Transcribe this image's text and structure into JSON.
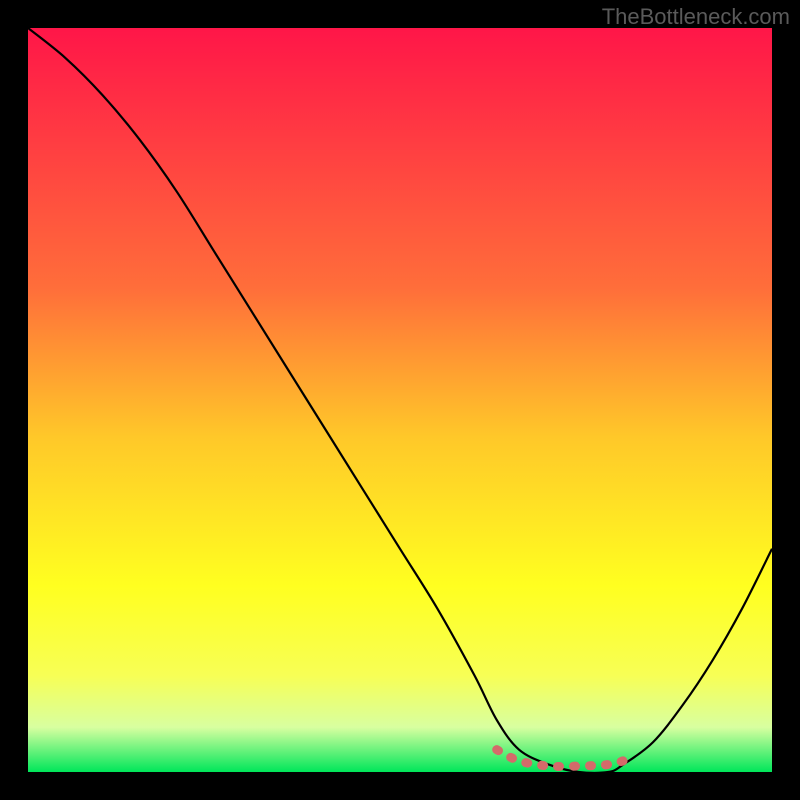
{
  "watermark": "TheBottleneck.com",
  "chart_data": {
    "type": "line",
    "title": "",
    "xlabel": "",
    "ylabel": "",
    "xlim": [
      0,
      100
    ],
    "ylim": [
      0,
      100
    ],
    "gradient_stops": [
      {
        "offset": 0,
        "color": "#ff1648"
      },
      {
        "offset": 35,
        "color": "#ff6e3a"
      },
      {
        "offset": 55,
        "color": "#ffc829"
      },
      {
        "offset": 75,
        "color": "#ffff20"
      },
      {
        "offset": 87,
        "color": "#f7ff55"
      },
      {
        "offset": 94,
        "color": "#d8ffa0"
      },
      {
        "offset": 100,
        "color": "#00e65a"
      }
    ],
    "series": [
      {
        "name": "bottleneck-curve",
        "color": "#000000",
        "x": [
          0,
          5,
          10,
          15,
          20,
          25,
          30,
          35,
          40,
          45,
          50,
          55,
          60,
          63,
          66,
          70,
          74,
          78,
          80,
          84,
          88,
          92,
          96,
          100
        ],
        "y": [
          100,
          96,
          91,
          85,
          78,
          70,
          62,
          54,
          46,
          38,
          30,
          22,
          13,
          7,
          3,
          1,
          0,
          0,
          1,
          4,
          9,
          15,
          22,
          30
        ]
      },
      {
        "name": "optimal-range-marker",
        "color": "#d46a6a",
        "x": [
          63,
          66,
          70,
          74,
          78,
          80
        ],
        "y": [
          3,
          1.5,
          0.8,
          0.8,
          1,
          1.5
        ]
      }
    ]
  }
}
